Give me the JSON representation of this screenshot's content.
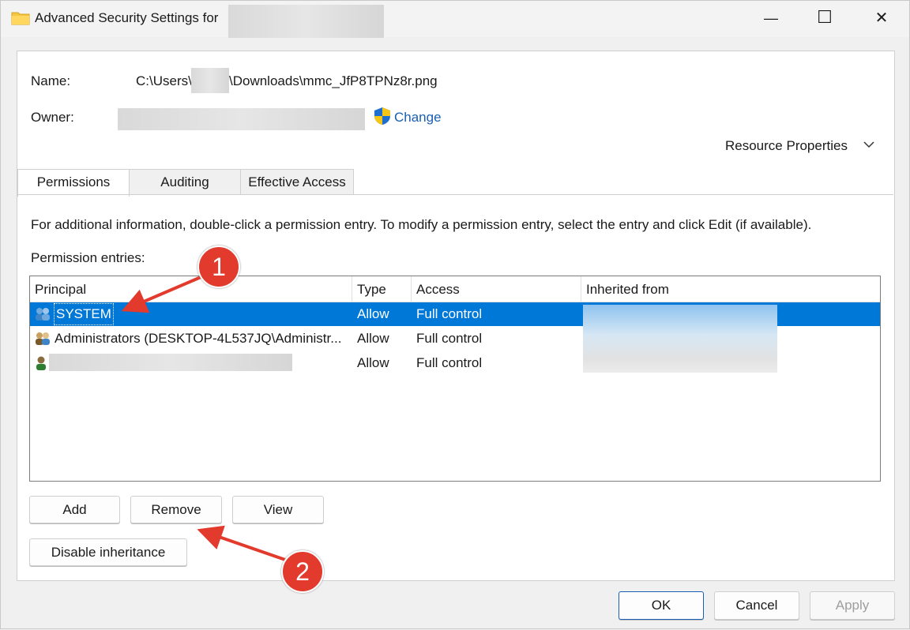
{
  "window": {
    "title": "Advanced Security Settings for",
    "controls": {
      "minimize": "—",
      "maximize": "☐",
      "close": "✕"
    }
  },
  "header": {
    "name_label": "Name:",
    "path_prefix": "C:\\Users\\",
    "path_suffix": "\\Downloads\\mmc_JfP8TPNz8r.png",
    "owner_label": "Owner:",
    "change_link": "Change",
    "resource_properties": "Resource Properties"
  },
  "tabs": [
    {
      "label": "Permissions",
      "active": true
    },
    {
      "label": "Auditing",
      "active": false
    },
    {
      "label": "Effective Access",
      "active": false
    }
  ],
  "info_text": "For additional information, double-click a permission entry. To modify a permission entry, select the entry and click Edit (if available).",
  "entries_label": "Permission entries:",
  "table": {
    "columns": [
      "Principal",
      "Type",
      "Access",
      "Inherited from"
    ],
    "rows": [
      {
        "principal": "SYSTEM",
        "type": "Allow",
        "access": "Full control",
        "icon": "group-users-icon",
        "selected": true
      },
      {
        "principal": "Administrators (DESKTOP-4L537JQ\\Administr...",
        "type": "Allow",
        "access": "Full control",
        "icon": "admin-users-icon",
        "selected": false
      },
      {
        "principal": "",
        "type": "Allow",
        "access": "Full control",
        "icon": "user-icon",
        "selected": false
      }
    ]
  },
  "buttons": {
    "add": "Add",
    "remove": "Remove",
    "view": "View",
    "disable_inheritance": "Disable inheritance",
    "ok": "OK",
    "cancel": "Cancel",
    "apply": "Apply"
  },
  "callouts": [
    "1",
    "2"
  ],
  "colors": {
    "selection": "#0078d7",
    "link": "#1a5fb4",
    "callout": "#e23a2c"
  }
}
